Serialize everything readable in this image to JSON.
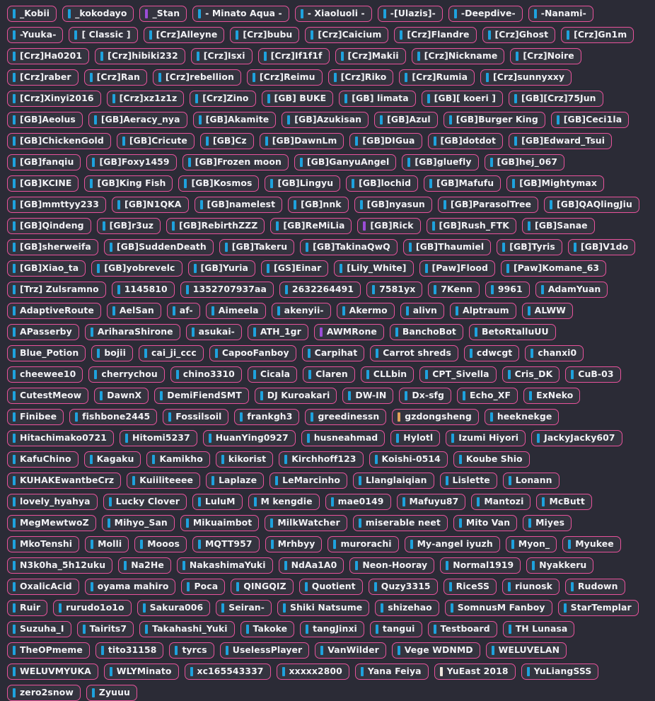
{
  "page": {
    "background_color": "#2b2b36",
    "chip_background_color": "#34343f",
    "chip_border_color": "#e8529b",
    "chip_text_color": "#f2f2f5",
    "bar_colors": {
      "blue": "#1ea2dd",
      "purple": "#9b4dd8",
      "orange": "#e0a35a",
      "cream": "#efe7dd"
    }
  },
  "tags": [
    {
      "label": "_Kobii",
      "bar": "blue"
    },
    {
      "label": "_kokodayo",
      "bar": "blue"
    },
    {
      "label": "_Stan",
      "bar": "purple"
    },
    {
      "label": "- Minato Aqua -",
      "bar": "blue"
    },
    {
      "label": "- Xiaoluoli -",
      "bar": "blue"
    },
    {
      "label": "-[Ulazis]-",
      "bar": "blue"
    },
    {
      "label": "-Deepdive-",
      "bar": "blue"
    },
    {
      "label": "-Nanami-",
      "bar": "blue"
    },
    {
      "label": "-Yuuka-",
      "bar": "blue"
    },
    {
      "label": "[ Classic ]",
      "bar": "blue"
    },
    {
      "label": "[Crz]Alleyne",
      "bar": "blue"
    },
    {
      "label": "[Crz]bubu",
      "bar": "blue"
    },
    {
      "label": "[Crz]Caicium",
      "bar": "blue"
    },
    {
      "label": "[Crz]Flandre",
      "bar": "blue"
    },
    {
      "label": "[Crz]Ghost",
      "bar": "blue"
    },
    {
      "label": "[Crz]Gn1m",
      "bar": "blue"
    },
    {
      "label": "[Crz]Ha0201",
      "bar": "blue"
    },
    {
      "label": "[Crz]hibiki232",
      "bar": "blue"
    },
    {
      "label": "[Crz]Isxi",
      "bar": "blue"
    },
    {
      "label": "[Crz]If1f1f",
      "bar": "blue"
    },
    {
      "label": "[Crz]Makii",
      "bar": "blue"
    },
    {
      "label": "[Crz]Nickname",
      "bar": "blue"
    },
    {
      "label": "[Crz]Noire",
      "bar": "blue"
    },
    {
      "label": "[Crz]raber",
      "bar": "blue"
    },
    {
      "label": "[Crz]Ran",
      "bar": "blue"
    },
    {
      "label": "[Crz]rebellion",
      "bar": "blue"
    },
    {
      "label": "[Crz]Reimu",
      "bar": "blue"
    },
    {
      "label": "[Crz]Riko",
      "bar": "blue"
    },
    {
      "label": "[Crz]Rumia",
      "bar": "blue"
    },
    {
      "label": "[Crz]sunnyxxy",
      "bar": "blue"
    },
    {
      "label": "[Crz]Xinyi2016",
      "bar": "blue"
    },
    {
      "label": "[Crz]xz1z1z",
      "bar": "blue"
    },
    {
      "label": "[Crz]Zino",
      "bar": "blue"
    },
    {
      "label": "[GB] BUKE",
      "bar": "blue"
    },
    {
      "label": "[GB] limata",
      "bar": "blue"
    },
    {
      "label": "[GB][ koeri ]",
      "bar": "blue"
    },
    {
      "label": "[GB][Crz]75Jun",
      "bar": "blue"
    },
    {
      "label": "[GB]Aeolus",
      "bar": "blue"
    },
    {
      "label": "[GB]Aeracy_nya",
      "bar": "blue"
    },
    {
      "label": "[GB]Akamite",
      "bar": "blue"
    },
    {
      "label": "[GB]Azukisan",
      "bar": "blue"
    },
    {
      "label": "[GB]Azul",
      "bar": "blue"
    },
    {
      "label": "[GB]Burger King",
      "bar": "blue"
    },
    {
      "label": "[GB]Ceci1la",
      "bar": "blue"
    },
    {
      "label": "[GB]ChickenGold",
      "bar": "blue"
    },
    {
      "label": "[GB]Cricute",
      "bar": "blue"
    },
    {
      "label": "[GB]Cz",
      "bar": "blue"
    },
    {
      "label": "[GB]DawnLm",
      "bar": "blue"
    },
    {
      "label": "[GB]DIGua",
      "bar": "blue"
    },
    {
      "label": "[GB]dotdot",
      "bar": "blue"
    },
    {
      "label": "[GB]Edward_Tsui",
      "bar": "blue"
    },
    {
      "label": "[GB]fanqiu",
      "bar": "blue"
    },
    {
      "label": "[GB]Foxy1459",
      "bar": "blue"
    },
    {
      "label": "[GB]Frozen moon",
      "bar": "blue"
    },
    {
      "label": "[GB]GanyuAngel",
      "bar": "blue"
    },
    {
      "label": "[GB]gluefly",
      "bar": "blue"
    },
    {
      "label": "[GB]hej_067",
      "bar": "blue"
    },
    {
      "label": "[GB]KCINE",
      "bar": "blue"
    },
    {
      "label": "[GB]King Fish",
      "bar": "blue"
    },
    {
      "label": "[GB]Kosmos",
      "bar": "blue"
    },
    {
      "label": "[GB]Lingyu",
      "bar": "blue"
    },
    {
      "label": "[GB]lochid",
      "bar": "blue"
    },
    {
      "label": "[GB]Mafufu",
      "bar": "blue"
    },
    {
      "label": "[GB]Mightymax",
      "bar": "blue"
    },
    {
      "label": "[GB]mmttyy233",
      "bar": "blue"
    },
    {
      "label": "[GB]N1QKA",
      "bar": "blue"
    },
    {
      "label": "[GB]namelest",
      "bar": "blue"
    },
    {
      "label": "[GB]nnk",
      "bar": "blue"
    },
    {
      "label": "[GB]nyasun",
      "bar": "blue"
    },
    {
      "label": "[GB]ParasolTree",
      "bar": "blue"
    },
    {
      "label": "[GB]QAQlingJiu",
      "bar": "blue"
    },
    {
      "label": "[GB]Qindeng",
      "bar": "blue"
    },
    {
      "label": "[GB]r3uz",
      "bar": "blue"
    },
    {
      "label": "[GB]RebirthZZZ",
      "bar": "blue"
    },
    {
      "label": "[GB]ReMiLia",
      "bar": "blue"
    },
    {
      "label": "[GB]Rick",
      "bar": "purple"
    },
    {
      "label": "[GB]Rush_FTK",
      "bar": "blue"
    },
    {
      "label": "[GB]Sanae",
      "bar": "blue"
    },
    {
      "label": "[GB]sherweifa",
      "bar": "blue"
    },
    {
      "label": "[GB]SuddenDeath",
      "bar": "blue"
    },
    {
      "label": "[GB]Takeru",
      "bar": "blue"
    },
    {
      "label": "[GB]TakinaQwQ",
      "bar": "blue"
    },
    {
      "label": "[GB]Thaumiel",
      "bar": "blue"
    },
    {
      "label": "[GB]Tyris",
      "bar": "blue"
    },
    {
      "label": "[GB]V1do",
      "bar": "blue"
    },
    {
      "label": "[GB]Xiao_ta",
      "bar": "blue"
    },
    {
      "label": "[GB]yobrevelc",
      "bar": "blue"
    },
    {
      "label": "[GB]Yuria",
      "bar": "blue"
    },
    {
      "label": "[GS]Einar",
      "bar": "blue"
    },
    {
      "label": "[Lily_White]",
      "bar": "blue"
    },
    {
      "label": "[Paw]Flood",
      "bar": "blue"
    },
    {
      "label": "[Paw]Komane_63",
      "bar": "blue"
    },
    {
      "label": "[Trz] Zulsramno",
      "bar": "blue"
    },
    {
      "label": "1145810",
      "bar": "blue"
    },
    {
      "label": "1352707937aa",
      "bar": "blue"
    },
    {
      "label": "2632264491",
      "bar": "blue"
    },
    {
      "label": "7581yx",
      "bar": "blue"
    },
    {
      "label": "7Kenn",
      "bar": "blue"
    },
    {
      "label": "9961",
      "bar": "blue"
    },
    {
      "label": "AdamYuan",
      "bar": "blue"
    },
    {
      "label": "AdaptiveRoute",
      "bar": "blue"
    },
    {
      "label": "AelSan",
      "bar": "blue"
    },
    {
      "label": "af-",
      "bar": "blue"
    },
    {
      "label": "Aimeela",
      "bar": "blue"
    },
    {
      "label": "akenyii-",
      "bar": "blue"
    },
    {
      "label": "Akermo",
      "bar": "blue"
    },
    {
      "label": "alivn",
      "bar": "blue"
    },
    {
      "label": "Alptraum",
      "bar": "blue"
    },
    {
      "label": "ALWW",
      "bar": "blue"
    },
    {
      "label": "APasserby",
      "bar": "blue"
    },
    {
      "label": "AriharaShirone",
      "bar": "blue"
    },
    {
      "label": "asukai-",
      "bar": "blue"
    },
    {
      "label": "ATH_1gr",
      "bar": "blue"
    },
    {
      "label": "AWMRone",
      "bar": "purple"
    },
    {
      "label": "BanchoBot",
      "bar": "blue"
    },
    {
      "label": "BetoRtalluUU",
      "bar": "blue"
    },
    {
      "label": "Blue_Potion",
      "bar": "blue"
    },
    {
      "label": "bojii",
      "bar": "blue"
    },
    {
      "label": "cai_ji_ccc",
      "bar": "blue"
    },
    {
      "label": "CapooFanboy",
      "bar": "blue"
    },
    {
      "label": "Carpihat",
      "bar": "blue"
    },
    {
      "label": "Carrot shreds",
      "bar": "blue"
    },
    {
      "label": "cdwcgt",
      "bar": "blue"
    },
    {
      "label": "chanxi0",
      "bar": "blue"
    },
    {
      "label": "cheewee10",
      "bar": "blue"
    },
    {
      "label": "cherrychou",
      "bar": "blue"
    },
    {
      "label": "chino3310",
      "bar": "blue"
    },
    {
      "label": "Cicala",
      "bar": "blue"
    },
    {
      "label": "Claren",
      "bar": "blue"
    },
    {
      "label": "CLLbin",
      "bar": "blue"
    },
    {
      "label": "CPT_Sivella",
      "bar": "blue"
    },
    {
      "label": "Cris_DK",
      "bar": "blue"
    },
    {
      "label": "CuB-03",
      "bar": "blue"
    },
    {
      "label": "CutestMeow",
      "bar": "blue"
    },
    {
      "label": "DawnX",
      "bar": "blue"
    },
    {
      "label": "DemiFiendSMT",
      "bar": "blue"
    },
    {
      "label": "DJ Kuroakari",
      "bar": "blue"
    },
    {
      "label": "DW-IN",
      "bar": "blue"
    },
    {
      "label": "Dx-sfg",
      "bar": "blue"
    },
    {
      "label": "Echo_XF",
      "bar": "blue"
    },
    {
      "label": "ExNeko",
      "bar": "blue"
    },
    {
      "label": "Finibee",
      "bar": "blue"
    },
    {
      "label": "fishbone2445",
      "bar": "blue"
    },
    {
      "label": "Fossilsoil",
      "bar": "blue"
    },
    {
      "label": "frankgh3",
      "bar": "blue"
    },
    {
      "label": "greedinessn",
      "bar": "blue"
    },
    {
      "label": "gzdongsheng",
      "bar": "orange"
    },
    {
      "label": "heeknekge",
      "bar": "blue"
    },
    {
      "label": "Hitachimako0721",
      "bar": "blue"
    },
    {
      "label": "Hitomi5237",
      "bar": "blue"
    },
    {
      "label": "HuanYing0927",
      "bar": "blue"
    },
    {
      "label": "husneahmad",
      "bar": "blue"
    },
    {
      "label": "Hylotl",
      "bar": "blue"
    },
    {
      "label": "Izumi Hiyori",
      "bar": "blue"
    },
    {
      "label": "JackyJacky607",
      "bar": "blue"
    },
    {
      "label": "KafuChino",
      "bar": "blue"
    },
    {
      "label": "Kagaku",
      "bar": "blue"
    },
    {
      "label": "Kamikho",
      "bar": "blue"
    },
    {
      "label": "kikorist",
      "bar": "blue"
    },
    {
      "label": "Kirchhoff123",
      "bar": "blue"
    },
    {
      "label": "Koishi-0514",
      "bar": "blue"
    },
    {
      "label": "Koube Shio",
      "bar": "blue"
    },
    {
      "label": "KUHAKEwantbeCrz",
      "bar": "blue"
    },
    {
      "label": "Kuiiliteeee",
      "bar": "blue"
    },
    {
      "label": "Laplaze",
      "bar": "blue"
    },
    {
      "label": "LeMarcinho",
      "bar": "blue"
    },
    {
      "label": "Llanglaiqian",
      "bar": "blue"
    },
    {
      "label": "Lislette",
      "bar": "blue"
    },
    {
      "label": "Lonann",
      "bar": "blue"
    },
    {
      "label": "lovely_hyahya",
      "bar": "blue"
    },
    {
      "label": "Lucky Clover",
      "bar": "blue"
    },
    {
      "label": "LuluM",
      "bar": "blue"
    },
    {
      "label": "M kengdie",
      "bar": "blue"
    },
    {
      "label": "mae0149",
      "bar": "blue"
    },
    {
      "label": "Mafuyu87",
      "bar": "blue"
    },
    {
      "label": "Mantozi",
      "bar": "blue"
    },
    {
      "label": "McButt",
      "bar": "blue"
    },
    {
      "label": "MegMewtwoZ",
      "bar": "blue"
    },
    {
      "label": "Mihyo_San",
      "bar": "blue"
    },
    {
      "label": "Mikuaimbot",
      "bar": "blue"
    },
    {
      "label": "MilkWatcher",
      "bar": "blue"
    },
    {
      "label": "miserable neet",
      "bar": "blue"
    },
    {
      "label": "Mito Van",
      "bar": "blue"
    },
    {
      "label": "Miyes",
      "bar": "blue"
    },
    {
      "label": "MkoTenshi",
      "bar": "blue"
    },
    {
      "label": "Molli",
      "bar": "blue"
    },
    {
      "label": "Mooos",
      "bar": "blue"
    },
    {
      "label": "MQTT957",
      "bar": "blue"
    },
    {
      "label": "Mrhbyy",
      "bar": "blue"
    },
    {
      "label": "murorachi",
      "bar": "blue"
    },
    {
      "label": "My-angel iyuzh",
      "bar": "blue"
    },
    {
      "label": "Myon_",
      "bar": "blue"
    },
    {
      "label": "Myukee",
      "bar": "blue"
    },
    {
      "label": "N3k0ha_5h12uku",
      "bar": "blue"
    },
    {
      "label": "Na2He",
      "bar": "blue"
    },
    {
      "label": "NakashimaYuki",
      "bar": "blue"
    },
    {
      "label": "NdAa1A0",
      "bar": "blue"
    },
    {
      "label": "Neon-Hooray",
      "bar": "blue"
    },
    {
      "label": "Normal1919",
      "bar": "blue"
    },
    {
      "label": "Nyakkeru",
      "bar": "blue"
    },
    {
      "label": "OxalicAcid",
      "bar": "blue"
    },
    {
      "label": "oyama mahiro",
      "bar": "blue"
    },
    {
      "label": "Poca",
      "bar": "blue"
    },
    {
      "label": "QINGQIZ",
      "bar": "blue"
    },
    {
      "label": "Quotient",
      "bar": "blue"
    },
    {
      "label": "Quzy3315",
      "bar": "blue"
    },
    {
      "label": "RiceSS",
      "bar": "blue"
    },
    {
      "label": "riunosk",
      "bar": "blue"
    },
    {
      "label": "Rudown",
      "bar": "blue"
    },
    {
      "label": "Ruir",
      "bar": "blue"
    },
    {
      "label": "rurudo1o1o",
      "bar": "blue"
    },
    {
      "label": "Sakura006",
      "bar": "blue"
    },
    {
      "label": "Seiran-",
      "bar": "blue"
    },
    {
      "label": "Shiki Natsume",
      "bar": "blue"
    },
    {
      "label": "shizehao",
      "bar": "blue"
    },
    {
      "label": "SomnusM Fanboy",
      "bar": "blue"
    },
    {
      "label": "StarTemplar",
      "bar": "blue"
    },
    {
      "label": "Suzuha_I",
      "bar": "blue"
    },
    {
      "label": "Tairits7",
      "bar": "blue"
    },
    {
      "label": "Takahashi_Yuki",
      "bar": "blue"
    },
    {
      "label": "Takoke",
      "bar": "blue"
    },
    {
      "label": "tangJinxi",
      "bar": "blue"
    },
    {
      "label": "tangui",
      "bar": "blue"
    },
    {
      "label": "Testboard",
      "bar": "blue"
    },
    {
      "label": "TH Lunasa",
      "bar": "blue"
    },
    {
      "label": "TheOPmeme",
      "bar": "blue"
    },
    {
      "label": "tito31158",
      "bar": "blue"
    },
    {
      "label": "tyrcs",
      "bar": "blue"
    },
    {
      "label": "UselessPlayer",
      "bar": "blue"
    },
    {
      "label": "VanWilder",
      "bar": "blue"
    },
    {
      "label": "Vege WDNMD",
      "bar": "blue"
    },
    {
      "label": "WELUVELAN",
      "bar": "blue"
    },
    {
      "label": "WELUVMYUKA",
      "bar": "blue"
    },
    {
      "label": "WLYMinato",
      "bar": "blue"
    },
    {
      "label": "xc165543337",
      "bar": "blue"
    },
    {
      "label": "xxxxx2800",
      "bar": "blue"
    },
    {
      "label": "Yana Feiya",
      "bar": "blue"
    },
    {
      "label": "YuEast 2018",
      "bar": "cream"
    },
    {
      "label": "YuLiangSSS",
      "bar": "blue"
    },
    {
      "label": "zero2snow",
      "bar": "blue"
    },
    {
      "label": "Zyuuu",
      "bar": "blue"
    }
  ]
}
